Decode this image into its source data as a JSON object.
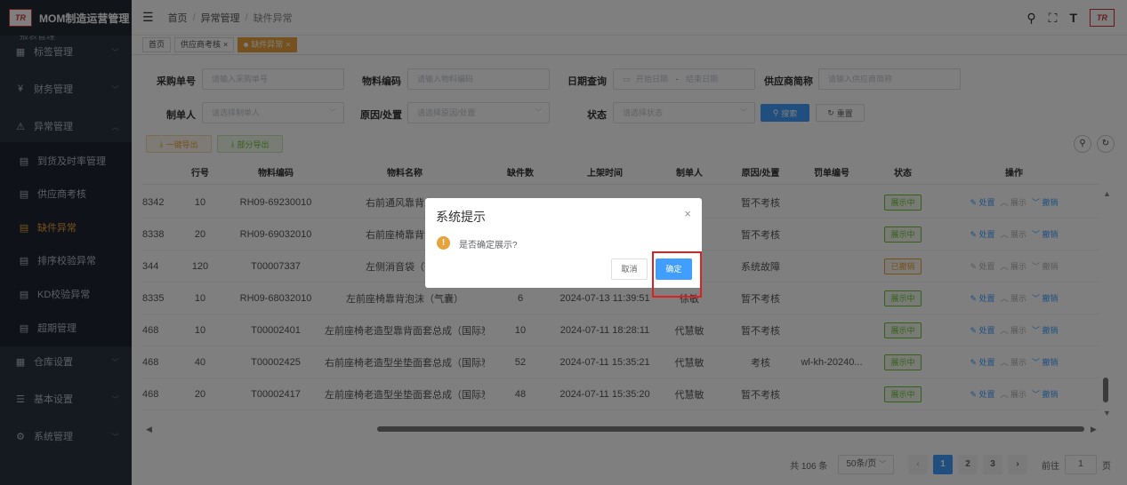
{
  "app": {
    "title": "MOM制造运营管理",
    "logo_text": "TR"
  },
  "sidebar": {
    "cut_item": "报表管理",
    "items": [
      {
        "label": "标签管理",
        "icon": "grid-icon",
        "chev": "﹀"
      },
      {
        "label": "财务管理",
        "icon": "yen-icon",
        "chev": "﹀"
      },
      {
        "label": "异常管理",
        "icon": "alert-icon",
        "chev": "︿"
      },
      {
        "label": "到货及时率管理",
        "icon": "doc-icon"
      },
      {
        "label": "供应商考核",
        "icon": "doc-icon"
      },
      {
        "label": "缺件异常",
        "icon": "doc-icon",
        "active": true
      },
      {
        "label": "排序校验异常",
        "icon": "doc-icon"
      },
      {
        "label": "KD校验异常",
        "icon": "doc-icon"
      },
      {
        "label": "超期管理",
        "icon": "doc-icon"
      },
      {
        "label": "仓库设置",
        "icon": "grid-icon",
        "chev": "﹀"
      },
      {
        "label": "基本设置",
        "icon": "sliders-icon",
        "chev": "﹀"
      },
      {
        "label": "系统管理",
        "icon": "gear-icon",
        "chev": "﹀"
      }
    ]
  },
  "breadcrumb": {
    "home": "首页",
    "sep": "/",
    "level1": "异常管理",
    "level2": "缺件异常"
  },
  "tabs": [
    {
      "label": "首页"
    },
    {
      "label": "供应商考核",
      "close": "×"
    },
    {
      "label": "缺件异常",
      "close": "×"
    }
  ],
  "filters": {
    "purchase_no": {
      "label": "采购单号",
      "placeholder": "请输入采购单号"
    },
    "material_code": {
      "label": "物料编码",
      "placeholder": "请输入物料编码"
    },
    "date": {
      "label": "日期查询",
      "start": "开始日期",
      "dash": "-",
      "end": "结束日期"
    },
    "supplier": {
      "label": "供应商简称",
      "placeholder": "请输入供应商简称"
    },
    "creator": {
      "label": "制单人",
      "placeholder": "请选择制单人"
    },
    "reason": {
      "label": "原因/处置",
      "placeholder": "请选择原因/处置"
    },
    "status": {
      "label": "状态",
      "placeholder": "请选择状态"
    },
    "search": "搜索",
    "reset": "重置"
  },
  "actions": {
    "export_all": "一键导出",
    "export_part": "部分导出"
  },
  "table": {
    "columns": [
      "行号",
      "物料编码",
      "物料名称",
      "缺件数",
      "上架时间",
      "制单人",
      "原因/处置",
      "罚单编号",
      "状态",
      "操作"
    ],
    "ops": {
      "handle": "处置",
      "show": "展示",
      "revoke": "撤销"
    },
    "rows": [
      {
        "po": "8342",
        "line": "10",
        "code": "RH09-69230010",
        "name": "右前通风靠背发泡",
        "qty": "",
        "time": "",
        "user": "",
        "reason": "暂不考核",
        "ticket": "",
        "status": "展示中",
        "st": "ok",
        "handle_on": true,
        "revoke_on": true
      },
      {
        "po": "8338",
        "line": "20",
        "code": "RH09-69032010",
        "name": "右前座椅靠背泡沫",
        "qty": "",
        "time": "",
        "user": "",
        "reason": "暂不考核",
        "ticket": "",
        "status": "展示中",
        "st": "ok",
        "handle_on": true,
        "revoke_on": true
      },
      {
        "po": "344",
        "line": "120",
        "code": "T00007337",
        "name": "左侧消音袋（带扶",
        "qty": "",
        "time": "",
        "user": "",
        "reason": "系统故障",
        "ticket": "",
        "status": "已撤销",
        "st": "warn",
        "handle_on": false,
        "revoke_on": false
      },
      {
        "po": "8335",
        "line": "10",
        "code": "RH09-68032010",
        "name": "左前座椅靠背泡沫（气囊）",
        "qty": "6",
        "time": "2024-07-13 11:39:51",
        "user": "徐敏",
        "reason": "暂不考核",
        "ticket": "",
        "status": "展示中",
        "st": "ok",
        "handle_on": true,
        "revoke_on": true
      },
      {
        "po": "468",
        "line": "10",
        "code": "T00002401",
        "name": "左前座椅老造型靠背面套总成（国际炭...",
        "qty": "10",
        "time": "2024-07-11 18:28:11",
        "user": "代慧敏",
        "reason": "暂不考核",
        "ticket": "",
        "status": "展示中",
        "st": "ok",
        "handle_on": true,
        "revoke_on": true
      },
      {
        "po": "468",
        "line": "40",
        "code": "T00002425",
        "name": "右前座椅老造型坐垫面套总成（国际炭...",
        "qty": "52",
        "time": "2024-07-11 15:35:21",
        "user": "代慧敏",
        "reason": "考核",
        "ticket": "wl-kh-20240...",
        "status": "展示中",
        "st": "ok",
        "handle_on": true,
        "revoke_on": true
      },
      {
        "po": "468",
        "line": "20",
        "code": "T00002417",
        "name": "左前座椅老造型坐垫面套总成（国际炭...",
        "qty": "48",
        "time": "2024-07-11 15:35:20",
        "user": "代慧敏",
        "reason": "暂不考核",
        "ticket": "",
        "status": "展示中",
        "st": "ok",
        "handle_on": true,
        "revoke_on": true
      }
    ]
  },
  "pagination": {
    "total": "共 106 条",
    "size": "50条/页",
    "pages": [
      "1",
      "2",
      "3"
    ],
    "goto": "前往",
    "page_input": "1",
    "page_unit": "页"
  },
  "dialog": {
    "title": "系统提示",
    "message": "是否确定展示?",
    "cancel": "取消",
    "confirm": "确定",
    "warn_glyph": "!",
    "close": "×"
  }
}
